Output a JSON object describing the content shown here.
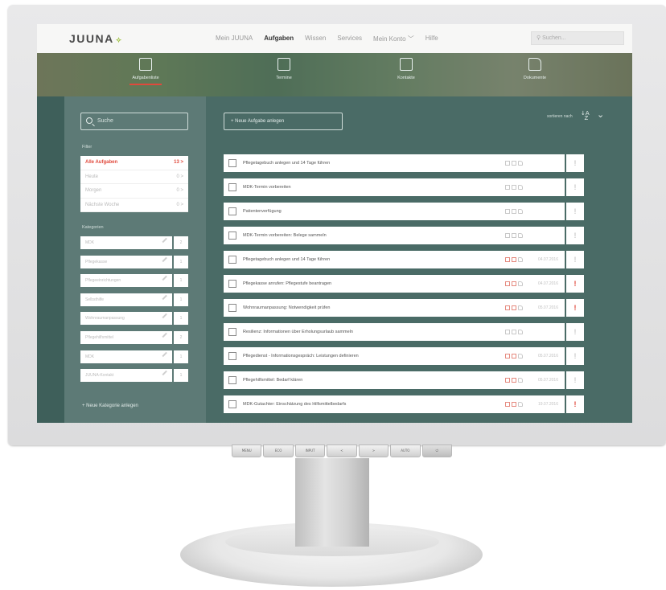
{
  "app": {
    "logo": "JUUNA",
    "nav": [
      {
        "label": "Mein JUUNA",
        "active": false
      },
      {
        "label": "Aufgaben",
        "active": true
      },
      {
        "label": "Wissen",
        "active": false
      },
      {
        "label": "Services",
        "active": false
      },
      {
        "label": "Mein Konto ﹀",
        "active": false
      },
      {
        "label": "Hilfe",
        "active": false
      }
    ],
    "search_placeholder": "Suchen..."
  },
  "tabs": [
    {
      "label": "Aufgabenliste",
      "icon": "task-list-icon",
      "active": true
    },
    {
      "label": "Termine",
      "icon": "calendar-icon",
      "active": false
    },
    {
      "label": "Kontakte",
      "icon": "contacts-icon",
      "active": false
    },
    {
      "label": "Dokumente",
      "icon": "folder-icon",
      "active": false
    }
  ],
  "sidebar": {
    "search_placeholder": "Suche",
    "filter_heading": "Filter",
    "filters": [
      {
        "label": "Alle Aufgaben",
        "count": "13 >",
        "active": true
      },
      {
        "label": "Heute",
        "count": "0 >",
        "active": false
      },
      {
        "label": "Morgen",
        "count": "0 >",
        "active": false
      },
      {
        "label": "Nächste Woche",
        "count": "0 >",
        "active": false
      }
    ],
    "category_heading": "Kategorien",
    "categories": [
      {
        "label": "MDK",
        "count": "2"
      },
      {
        "label": "Pflegekasse",
        "count": "1"
      },
      {
        "label": "Pflegeeinrichtungen",
        "count": "1"
      },
      {
        "label": "Selbsthilfe",
        "count": "1"
      },
      {
        "label": "Wohnraumanpassung",
        "count": "1"
      },
      {
        "label": "Pflegehilfsmittel",
        "count": "2"
      },
      {
        "label": "MDK",
        "count": "1"
      },
      {
        "label": "JUUNA-Kontakt",
        "count": "1"
      }
    ],
    "add_category": "+   Neue Kategorie anlegen"
  },
  "main": {
    "new_task": "+   Neue Aufgabe anlegen",
    "sort_label": "sortieren nach",
    "sort_icon": "sort-az-icon",
    "tasks": [
      {
        "title": "Pflegetagebuch anlegen und 14 Tage führen",
        "date": "",
        "red": false,
        "priority": false
      },
      {
        "title": "MDK-Termin vorbereiten",
        "date": "",
        "red": false,
        "priority": false
      },
      {
        "title": "Patientenverfügung",
        "date": "",
        "red": false,
        "priority": false
      },
      {
        "title": "MDK-Termin vorbereiten: Belege sammeln",
        "date": "",
        "red": false,
        "priority": false
      },
      {
        "title": "Pflegetagebuch anlegen und 14 Tage führen",
        "date": "04.07.2016",
        "red": true,
        "priority": false
      },
      {
        "title": "Pflegekasse anrufen: Pflegestufe beantragen",
        "date": "04.07.2016",
        "red": true,
        "priority": true
      },
      {
        "title": "Wohnraumanpassung: Notwendigkeit prüfen",
        "date": "05.07.2016",
        "red": true,
        "priority": true
      },
      {
        "title": "Resilienz: Informationen über Erholungsurlaub sammeln",
        "date": "",
        "red": false,
        "priority": false
      },
      {
        "title": "Pflegedienst - Informationsgespräch: Leistungen definieren",
        "date": "05.07.2016",
        "red": true,
        "priority": false
      },
      {
        "title": "Pflegehilfsmittel: Bedarf klären",
        "date": "05.07.2016",
        "red": true,
        "priority": false
      },
      {
        "title": "MDK-Gutachter: Einschätzung des Hilfsmittelbedarfs",
        "date": "19.07.2016",
        "red": true,
        "priority": true
      }
    ]
  },
  "monitor_buttons": [
    "MENU",
    "ECO",
    "INPUT",
    "<",
    ">",
    "AUTO",
    "⏻"
  ],
  "colors": {
    "accent": "#e0493c",
    "panel": "#4b6c67",
    "brand_green": "#9bbf3a"
  }
}
